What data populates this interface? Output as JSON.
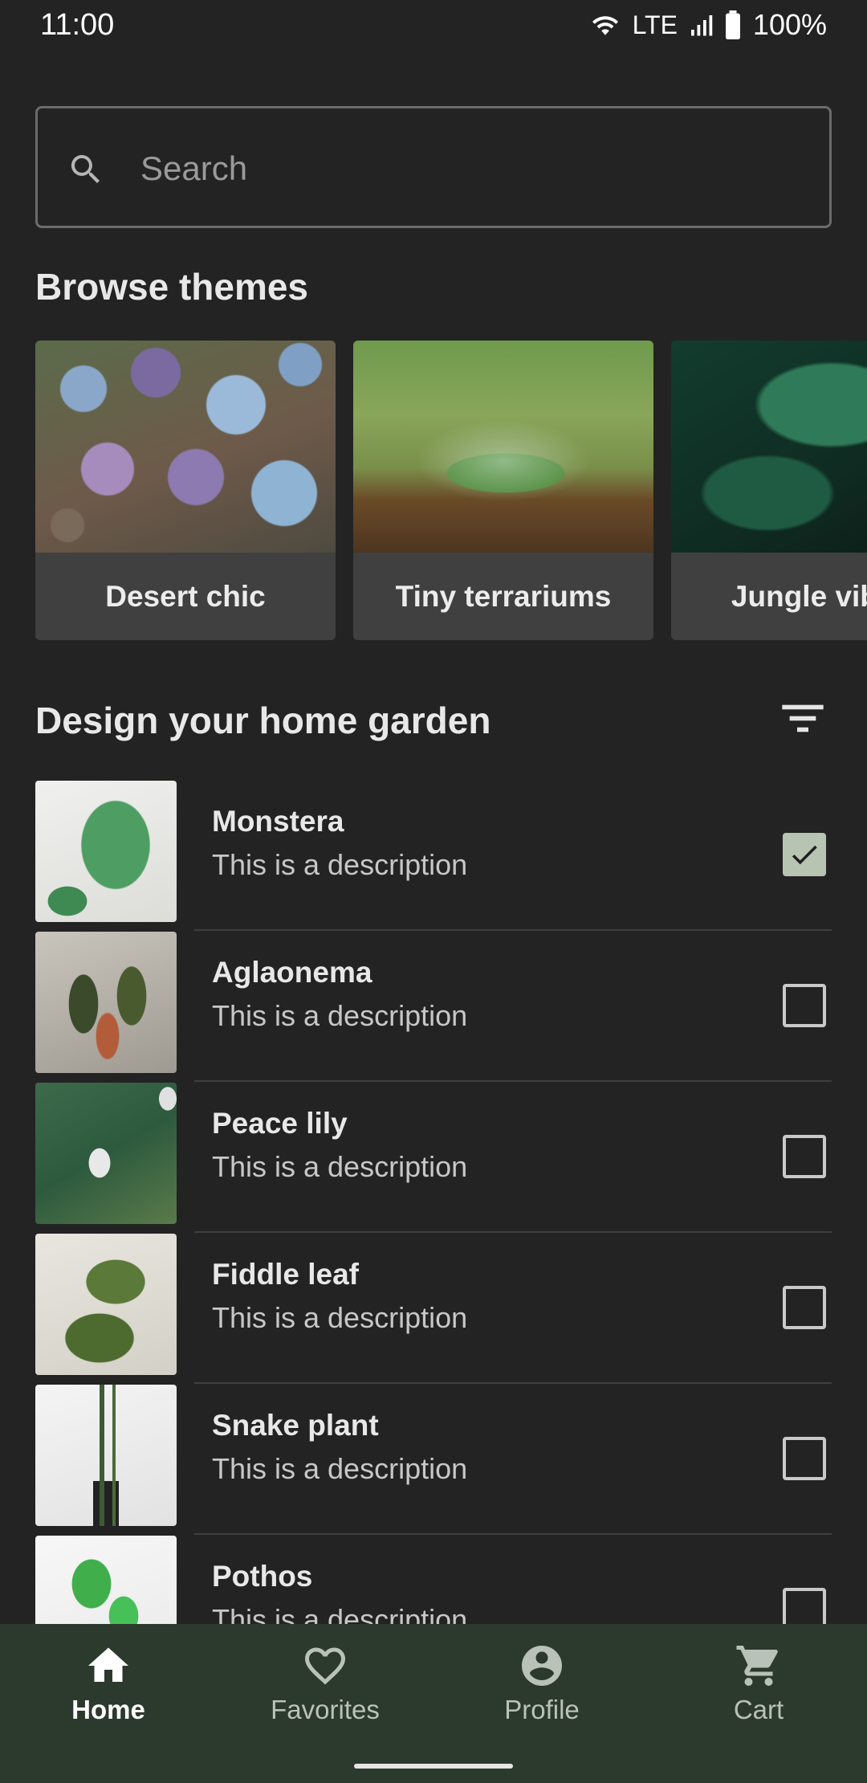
{
  "status_bar": {
    "time": "11:00",
    "network": "LTE",
    "battery": "100%"
  },
  "search": {
    "placeholder": "Search"
  },
  "themes": {
    "title": "Browse themes",
    "items": [
      {
        "label": "Desert chic"
      },
      {
        "label": "Tiny terrariums"
      },
      {
        "label": "Jungle vibes"
      }
    ]
  },
  "garden": {
    "title": "Design your home garden",
    "items": [
      {
        "name": "Monstera",
        "description": "This is a description",
        "checked": true
      },
      {
        "name": "Aglaonema",
        "description": "This is a description",
        "checked": false
      },
      {
        "name": "Peace lily",
        "description": "This is a description",
        "checked": false
      },
      {
        "name": "Fiddle leaf",
        "description": "This is a description",
        "checked": false
      },
      {
        "name": "Snake plant",
        "description": "This is a description",
        "checked": false
      },
      {
        "name": "Pothos",
        "description": "This is a description",
        "checked": false
      }
    ]
  },
  "nav": {
    "items": [
      {
        "label": "Home",
        "icon": "home-icon",
        "active": true
      },
      {
        "label": "Favorites",
        "icon": "heart-icon",
        "active": false
      },
      {
        "label": "Profile",
        "icon": "account-circle-icon",
        "active": false
      },
      {
        "label": "Cart",
        "icon": "cart-icon",
        "active": false
      }
    ]
  },
  "colors": {
    "background": "#232323",
    "nav_background": "#2c3a2d",
    "checkbox_checked": "#b7c4b1"
  }
}
